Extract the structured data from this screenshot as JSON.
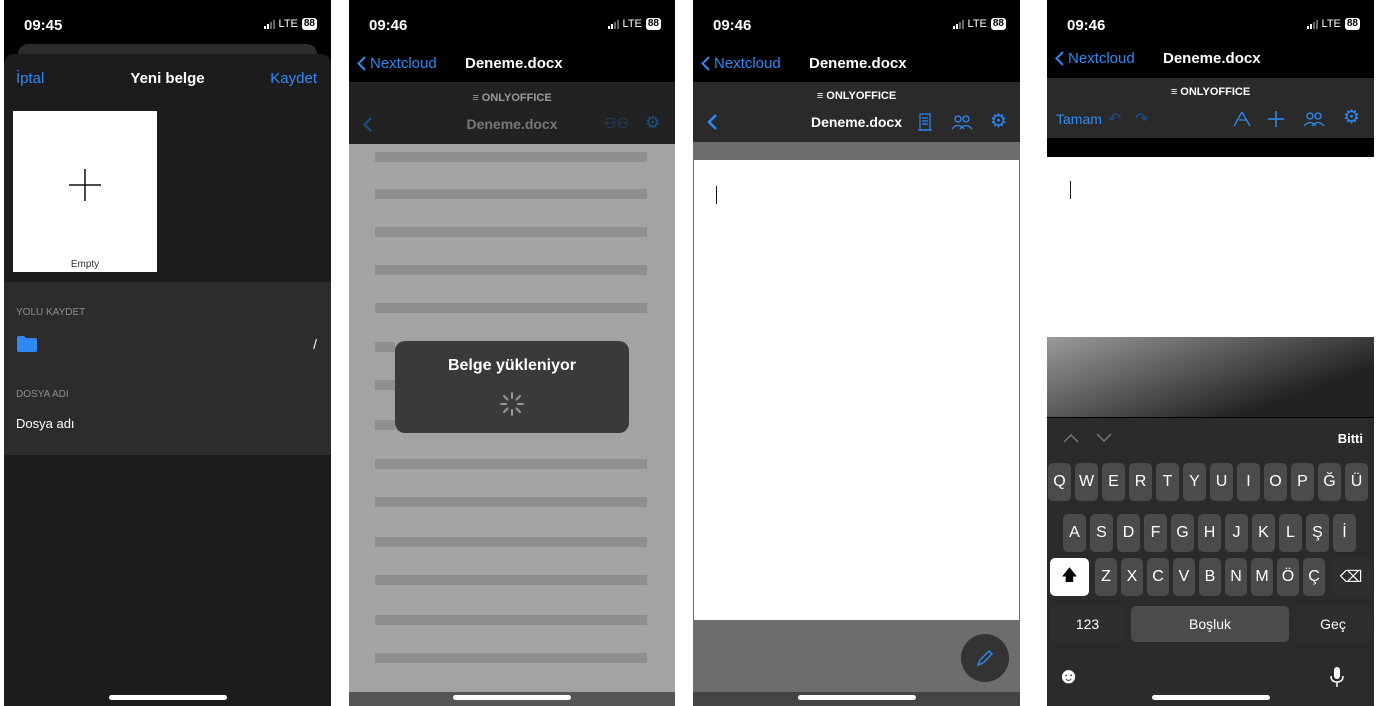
{
  "phone1": {
    "time": "09:45",
    "network": "LTE",
    "battery": "88",
    "nav": {
      "cancel": "İptal",
      "title": "Yeni belge",
      "save": "Kaydet"
    },
    "template": {
      "label": "Empty",
      "icon": "plus-icon"
    },
    "save_path": {
      "header": "YOLU KAYDET",
      "path": "/",
      "icon": "folder-icon"
    },
    "file_name": {
      "header": "DOSYA ADI",
      "placeholder": "Dosya adı"
    }
  },
  "phone2": {
    "time": "09:46",
    "network": "LTE",
    "battery": "88",
    "nav": {
      "back": "Nextcloud",
      "title": "Deneme.docx"
    },
    "brand": "ONLYOFFICE",
    "editor_title": "Deneme.docx",
    "loading": "Belge yükleniyor"
  },
  "phone3": {
    "time": "09:46",
    "network": "LTE",
    "battery": "88",
    "nav": {
      "back": "Nextcloud",
      "title": "Deneme.docx"
    },
    "brand": "ONLYOFFICE",
    "editor_title": "Deneme.docx"
  },
  "phone4": {
    "time": "09:46",
    "network": "LTE",
    "battery": "88",
    "nav": {
      "back": "Nextcloud",
      "title": "Deneme.docx"
    },
    "brand": "ONLYOFFICE",
    "done": "Tamam",
    "keyboard": {
      "done": "Bitti",
      "row1": [
        "Q",
        "W",
        "E",
        "R",
        "T",
        "Y",
        "U",
        "I",
        "O",
        "P",
        "Ğ",
        "Ü"
      ],
      "row2": [
        "A",
        "S",
        "D",
        "F",
        "G",
        "H",
        "J",
        "K",
        "L",
        "Ş",
        "İ"
      ],
      "row3": [
        "Z",
        "X",
        "C",
        "V",
        "B",
        "N",
        "M",
        "Ö",
        "Ç"
      ],
      "numbers": "123",
      "space": "Boşluk",
      "go": "Geç"
    }
  },
  "colors": {
    "accent": "#2f89f5",
    "background": "#1c1c1e"
  }
}
